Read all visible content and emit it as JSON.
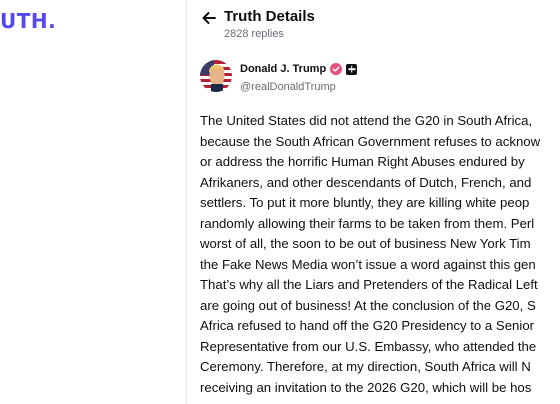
{
  "brand": {
    "logo_text": "UTH",
    "logo_dot": ".",
    "color": "#5448ee"
  },
  "header": {
    "title": "Truth Details",
    "replies": "2828 replies",
    "back_icon": "arrow-left-icon"
  },
  "post": {
    "author_name": "Donald J. Trump",
    "handle": "@realDonaldTrump",
    "verified_color": "#e8507c",
    "lines": [
      "The United States did not attend the G20 in South Africa,",
      "because the South African Government refuses to acknow",
      "or address the horrific Human Right Abuses endured by",
      "Afrikaners, and other descendants of Dutch, French, and",
      "settlers. To put it more bluntly, they are killing white peop",
      "randomly allowing their farms to be taken from them. Perl",
      "worst of all, the soon to be out of business New York Tim",
      "the Fake News Media won’t issue a word against this gen",
      "That’s why all the Liars and Pretenders of the Radical Left",
      "are going out of business! At the conclusion of the G20, S",
      "Africa refused to hand off the G20 Presidency to a Senior",
      "Representative from our U.S. Embassy, who attended the",
      "Ceremony. Therefore, at my direction, South Africa will N",
      "receiving an invitation to the 2026 G20, which will be hos"
    ]
  }
}
